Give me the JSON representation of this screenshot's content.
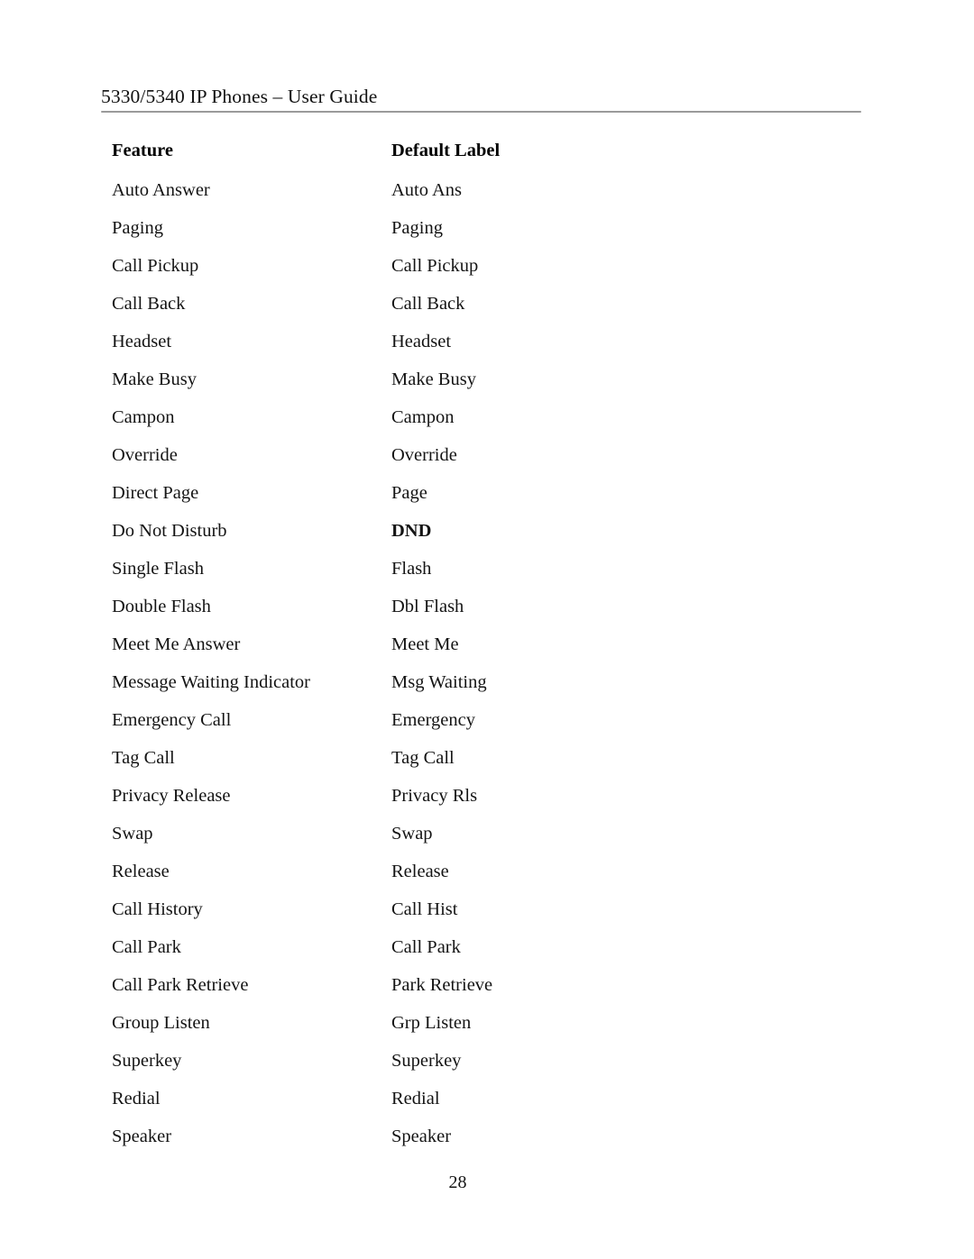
{
  "header": {
    "title": "5330/5340 IP Phones – User Guide"
  },
  "table": {
    "columns": {
      "feature": "Feature",
      "default_label": "Default Label"
    },
    "rows": [
      {
        "feature": "Auto Answer",
        "default_label": "Auto Ans"
      },
      {
        "feature": "Paging",
        "default_label": "Paging"
      },
      {
        "feature": "Call Pickup",
        "default_label": "Call Pickup"
      },
      {
        "feature": "Call Back",
        "default_label": "Call Back"
      },
      {
        "feature": "Headset",
        "default_label": "Headset"
      },
      {
        "feature": "Make Busy",
        "default_label": "Make Busy"
      },
      {
        "feature": "Campon",
        "default_label": "Campon"
      },
      {
        "feature": "Override",
        "default_label": "Override"
      },
      {
        "feature": "Direct Page",
        "default_label": "Page"
      },
      {
        "feature": "Do Not Disturb",
        "default_label": "DND"
      },
      {
        "feature": "Single Flash",
        "default_label": "Flash"
      },
      {
        "feature": "Double Flash",
        "default_label": "Dbl Flash"
      },
      {
        "feature": "Meet Me Answer",
        "default_label": "Meet Me"
      },
      {
        "feature": "Message Waiting Indicator",
        "default_label": "Msg Waiting"
      },
      {
        "feature": "Emergency Call",
        "default_label": "Emergency"
      },
      {
        "feature": "Tag Call",
        "default_label": "Tag Call"
      },
      {
        "feature": "Privacy Release",
        "default_label": "Privacy Rls"
      },
      {
        "feature": "Swap",
        "default_label": "Swap"
      },
      {
        "feature": "Release",
        "default_label": "Release"
      },
      {
        "feature": "Call History",
        "default_label": "Call Hist"
      },
      {
        "feature": "Call Park",
        "default_label": "Call Park"
      },
      {
        "feature": "Call Park Retrieve",
        "default_label": "Park Retrieve"
      },
      {
        "feature": "Group Listen",
        "default_label": "Grp Listen"
      },
      {
        "feature": "Superkey",
        "default_label": "Superkey"
      },
      {
        "feature": "Redial",
        "default_label": "Redial"
      },
      {
        "feature": "Speaker",
        "default_label": "Speaker"
      }
    ],
    "bold_default_labels": [
      "DND"
    ]
  },
  "footer": {
    "page_number": "28"
  },
  "colors": {
    "text": "#141414",
    "rule": "#9a9a9a",
    "background": "#ffffff"
  }
}
